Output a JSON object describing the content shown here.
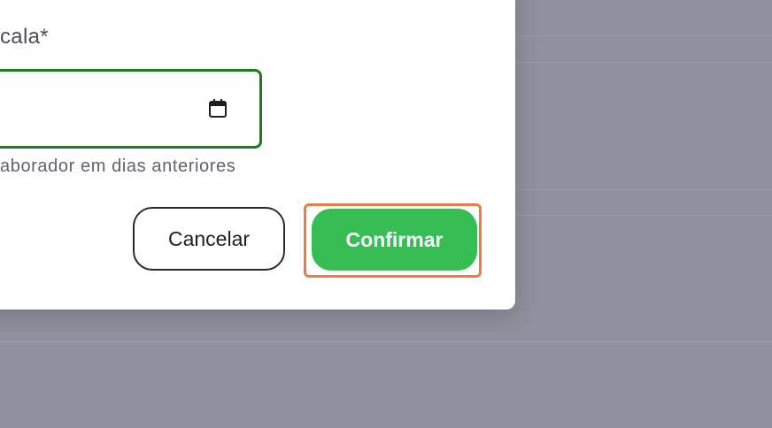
{
  "dialog": {
    "field_label": "cala*",
    "date_input_value": "",
    "helper_text": "aborador em dias anteriores"
  },
  "actions": {
    "cancel_label": "Cancelar",
    "confirm_label": "Confirmar"
  },
  "colors": {
    "overlay": "#8e919d",
    "input_border_focus": "#1f7a1f",
    "confirm_bg": "#36bd53",
    "highlight": "#f07a45"
  },
  "icons": {
    "date_picker": "calendar-icon"
  }
}
